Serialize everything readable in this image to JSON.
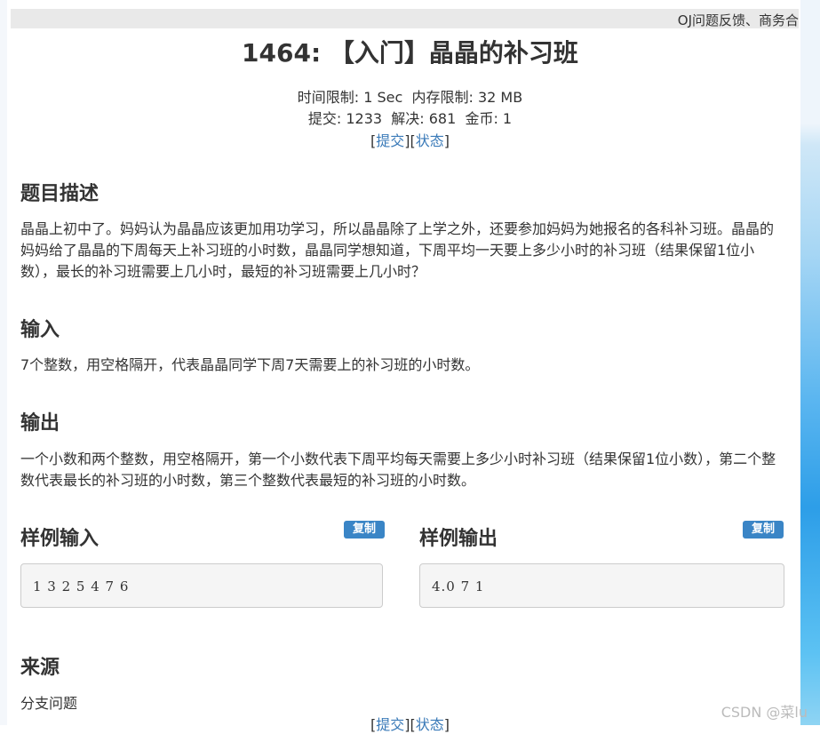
{
  "topbar": {
    "text": "OJ问题反馈、商务合"
  },
  "problem": {
    "title": "1464: 【入门】晶晶的补习班",
    "time_limit_label": "时间限制: 1 Sec",
    "memory_limit_label": "内存限制: 32 MB",
    "submit_count_label": "提交: 1233",
    "solved_label": "解决: 681",
    "coins_label": "金币: 1",
    "submit_link": "提交",
    "status_link": "状态"
  },
  "sections": {
    "description_title": "题目描述",
    "description_text": "晶晶上初中了。妈妈认为晶晶应该更加用功学习，所以晶晶除了上学之外，还要参加妈妈为她报名的各科补习班。晶晶的妈妈给了晶晶的下周每天上补习班的小时数，晶晶同学想知道，下周平均一天要上多少小时的补习班（结果保留1位小数），最长的补习班需要上几小时，最短的补习班需要上几小时？",
    "input_title": "输入",
    "input_text": "7个整数，用空格隔开，代表晶晶同学下周7天需要上的补习班的小时数。",
    "output_title": "输出",
    "output_text": "一个小数和两个整数，用空格隔开，第一个小数代表下周平均每天需要上多少小时补习班（结果保留1位小数），第二个整数代表最长的补习班的小时数，第三个整数代表最短的补习班的小时数。",
    "sample_input_title": "样例输入",
    "sample_input": "1 3 2 5 4 7 6",
    "sample_output_title": "样例输出",
    "sample_output": "4.0 7 1",
    "copy_label": "复制",
    "source_title": "来源",
    "source_link": "分支问题"
  },
  "watermark": "CSDN @菜lu",
  "colors": {
    "link": "#3a7ab8",
    "copy_button": "#3a85c6"
  }
}
